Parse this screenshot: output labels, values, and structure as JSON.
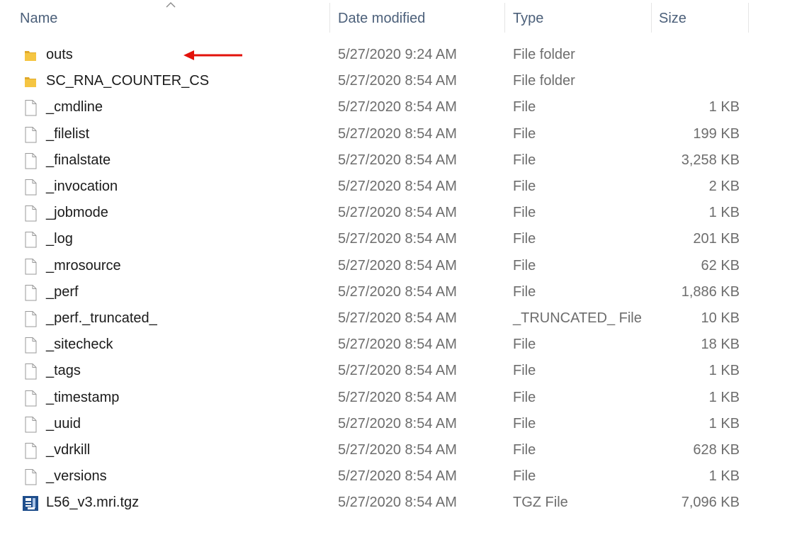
{
  "columns": {
    "name": "Name",
    "date_modified": "Date modified",
    "type": "Type",
    "size": "Size"
  },
  "files": [
    {
      "name": "outs",
      "date": "5/27/2020 9:24 AM",
      "type": "File folder",
      "size": "",
      "icon": "folder-icon"
    },
    {
      "name": "SC_RNA_COUNTER_CS",
      "date": "5/27/2020 8:54 AM",
      "type": "File folder",
      "size": "",
      "icon": "folder-icon"
    },
    {
      "name": "_cmdline",
      "date": "5/27/2020 8:54 AM",
      "type": "File",
      "size": "1 KB",
      "icon": "file-icon"
    },
    {
      "name": "_filelist",
      "date": "5/27/2020 8:54 AM",
      "type": "File",
      "size": "199 KB",
      "icon": "file-icon"
    },
    {
      "name": "_finalstate",
      "date": "5/27/2020 8:54 AM",
      "type": "File",
      "size": "3,258 KB",
      "icon": "file-icon"
    },
    {
      "name": "_invocation",
      "date": "5/27/2020 8:54 AM",
      "type": "File",
      "size": "2 KB",
      "icon": "file-icon"
    },
    {
      "name": "_jobmode",
      "date": "5/27/2020 8:54 AM",
      "type": "File",
      "size": "1 KB",
      "icon": "file-icon"
    },
    {
      "name": "_log",
      "date": "5/27/2020 8:54 AM",
      "type": "File",
      "size": "201 KB",
      "icon": "file-icon"
    },
    {
      "name": "_mrosource",
      "date": "5/27/2020 8:54 AM",
      "type": "File",
      "size": "62 KB",
      "icon": "file-icon"
    },
    {
      "name": "_perf",
      "date": "5/27/2020 8:54 AM",
      "type": "File",
      "size": "1,886 KB",
      "icon": "file-icon"
    },
    {
      "name": "_perf._truncated_",
      "date": "5/27/2020 8:54 AM",
      "type": "_TRUNCATED_ File",
      "size": "10 KB",
      "icon": "file-icon"
    },
    {
      "name": "_sitecheck",
      "date": "5/27/2020 8:54 AM",
      "type": "File",
      "size": "18 KB",
      "icon": "file-icon"
    },
    {
      "name": "_tags",
      "date": "5/27/2020 8:54 AM",
      "type": "File",
      "size": "1 KB",
      "icon": "file-icon"
    },
    {
      "name": "_timestamp",
      "date": "5/27/2020 8:54 AM",
      "type": "File",
      "size": "1 KB",
      "icon": "file-icon"
    },
    {
      "name": "_uuid",
      "date": "5/27/2020 8:54 AM",
      "type": "File",
      "size": "1 KB",
      "icon": "file-icon"
    },
    {
      "name": "_vdrkill",
      "date": "5/27/2020 8:54 AM",
      "type": "File",
      "size": "628 KB",
      "icon": "file-icon"
    },
    {
      "name": "_versions",
      "date": "5/27/2020 8:54 AM",
      "type": "File",
      "size": "1 KB",
      "icon": "file-icon"
    },
    {
      "name": "L56_v3.mri.tgz",
      "date": "5/27/2020 8:54 AM",
      "type": "TGZ File",
      "size": "7,096 KB",
      "icon": "archive-icon"
    }
  ],
  "sort": {
    "column": "name",
    "direction": "ascending",
    "icon": "sort-up-chevron-icon"
  },
  "annotation": {
    "icon": "red-arrow-icon",
    "points_to": "outs"
  },
  "colors": {
    "header_text": "#4c607a",
    "item_text": "#1b1b1b",
    "detail_text": "#6d6d6d",
    "folder": "#f5c542",
    "arrow": "#e3120b"
  }
}
